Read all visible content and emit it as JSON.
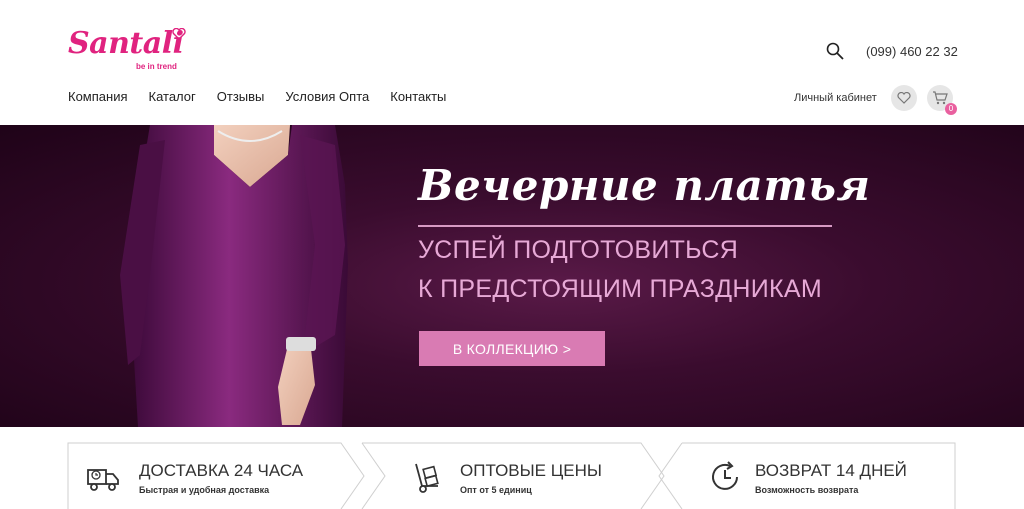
{
  "brand": {
    "name": "Santali",
    "tagline": "be in trend"
  },
  "header": {
    "phone": "(099) 460 22 32",
    "account_label": "Личный кабинет",
    "cart_count": "0"
  },
  "nav": {
    "items": [
      {
        "label": "Компания"
      },
      {
        "label": "Каталог"
      },
      {
        "label": "Отзывы"
      },
      {
        "label": "Условия Опта"
      },
      {
        "label": "Контакты"
      }
    ]
  },
  "banner": {
    "title": "Вечерние платья",
    "subtitle_line1": "УСПЕЙ ПОДГОТОВИТЬСЯ",
    "subtitle_line2": "К ПРЕДСТОЯЩИМ ПРАЗДНИКАМ",
    "button_label": "В КОЛЛЕКЦИЮ >"
  },
  "features": [
    {
      "icon": "delivery-truck-icon",
      "title": "ДОСТАВКА 24 ЧАСА",
      "desc": "Быстрая и удобная доставка"
    },
    {
      "icon": "hand-truck-icon",
      "title": "ОПТОВЫЕ ЦЕНЫ",
      "desc": "Опт от 5 единиц"
    },
    {
      "icon": "return-clock-icon",
      "title": "ВОЗВРАТ 14 ДНЕЙ",
      "desc": "Возможность возврата"
    }
  ],
  "colors": {
    "brand_pink": "#e0237f",
    "banner_dark": "#2a0720",
    "accent_pink": "#d97bb3",
    "subtitle_pink": "#e7a9d6"
  }
}
